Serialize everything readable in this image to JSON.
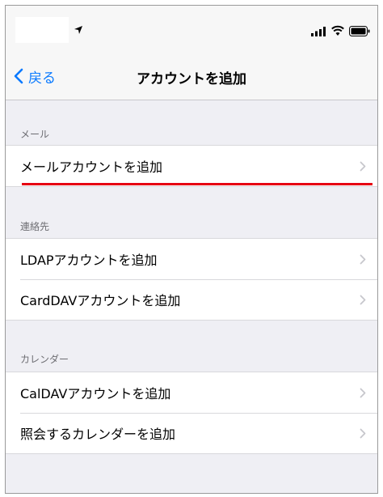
{
  "nav": {
    "back_label": "戻る",
    "title": "アカウントを追加"
  },
  "sections": [
    {
      "header": "メール",
      "rows": [
        "メールアカウントを追加"
      ]
    },
    {
      "header": "連絡先",
      "rows": [
        "LDAPアカウントを追加",
        "CardDAVアカウントを追加"
      ]
    },
    {
      "header": "カレンダー",
      "rows": [
        "CalDAVアカウントを追加",
        "照会するカレンダーを追加"
      ]
    }
  ],
  "colors": {
    "accent": "#0a7aff",
    "highlight": "#e60012",
    "background": "#efeff4"
  },
  "icons": [
    "location-icon",
    "signal-icon",
    "wifi-icon",
    "battery-icon",
    "back-chevron-icon",
    "chevron-right-icon"
  ]
}
